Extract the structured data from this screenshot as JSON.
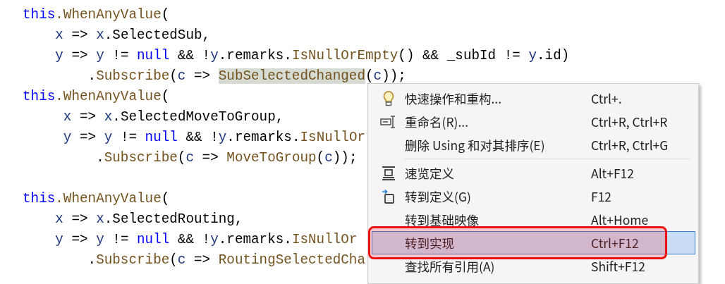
{
  "code_lines": [
    {
      "tokens": [
        {
          "text": "this",
          "kind": "keyword"
        },
        {
          "text": ".WhenAnyValue",
          "kind": "method"
        },
        {
          "text": "(",
          "kind": "plain"
        }
      ]
    },
    {
      "tokens": [
        {
          "text": "    x",
          "kind": "param"
        },
        {
          "text": " => ",
          "kind": "plain"
        },
        {
          "text": "x",
          "kind": "param"
        },
        {
          "text": ".SelectedSub,",
          "kind": "plain"
        }
      ]
    },
    {
      "tokens": [
        {
          "text": "    y",
          "kind": "param"
        },
        {
          "text": " => ",
          "kind": "plain"
        },
        {
          "text": "y",
          "kind": "param"
        },
        {
          "text": " != ",
          "kind": "plain"
        },
        {
          "text": "null",
          "kind": "keyword"
        },
        {
          "text": " && !",
          "kind": "plain"
        },
        {
          "text": "y",
          "kind": "param"
        },
        {
          "text": ".remarks.",
          "kind": "plain"
        },
        {
          "text": "IsNullOrEmpty",
          "kind": "method"
        },
        {
          "text": "() && _subId != ",
          "kind": "plain"
        },
        {
          "text": "y",
          "kind": "param"
        },
        {
          "text": ".id)",
          "kind": "plain"
        }
      ]
    },
    {
      "tokens": [
        {
          "text": "        .",
          "kind": "plain"
        },
        {
          "text": "Subscribe",
          "kind": "method"
        },
        {
          "text": "(",
          "kind": "plain"
        },
        {
          "text": "c",
          "kind": "param"
        },
        {
          "text": " => ",
          "kind": "plain"
        },
        {
          "text": "SubSelectedChanged",
          "kind": "method",
          "highlighted": true
        },
        {
          "text": "(",
          "kind": "plain"
        },
        {
          "text": "c",
          "kind": "param"
        },
        {
          "text": "));",
          "kind": "plain"
        }
      ]
    },
    {
      "tokens": [
        {
          "text": "this",
          "kind": "keyword"
        },
        {
          "text": ".WhenAnyValue",
          "kind": "method"
        },
        {
          "text": "(",
          "kind": "plain"
        }
      ]
    },
    {
      "tokens": [
        {
          "text": "     x",
          "kind": "param"
        },
        {
          "text": " => ",
          "kind": "plain"
        },
        {
          "text": "x",
          "kind": "param"
        },
        {
          "text": ".SelectedMoveToGroup,",
          "kind": "plain"
        }
      ]
    },
    {
      "tokens": [
        {
          "text": "     y",
          "kind": "param"
        },
        {
          "text": " => ",
          "kind": "plain"
        },
        {
          "text": "y",
          "kind": "param"
        },
        {
          "text": " != ",
          "kind": "plain"
        },
        {
          "text": "null",
          "kind": "keyword"
        },
        {
          "text": " && !",
          "kind": "plain"
        },
        {
          "text": "y",
          "kind": "param"
        },
        {
          "text": ".remarks.",
          "kind": "plain"
        },
        {
          "text": "IsNullOr",
          "kind": "method"
        }
      ]
    },
    {
      "tokens": [
        {
          "text": "         .",
          "kind": "plain"
        },
        {
          "text": "Subscribe",
          "kind": "method"
        },
        {
          "text": "(",
          "kind": "plain"
        },
        {
          "text": "c",
          "kind": "param"
        },
        {
          "text": " => ",
          "kind": "plain"
        },
        {
          "text": "MoveToGroup",
          "kind": "method"
        },
        {
          "text": "(",
          "kind": "plain"
        },
        {
          "text": "c",
          "kind": "param"
        },
        {
          "text": "));",
          "kind": "plain"
        }
      ]
    },
    {
      "blank_line_before": true,
      "tokens": [
        {
          "text": "this",
          "kind": "keyword"
        },
        {
          "text": ".WhenAnyValue",
          "kind": "method"
        },
        {
          "text": "(",
          "kind": "plain"
        }
      ]
    },
    {
      "tokens": [
        {
          "text": "    x",
          "kind": "param"
        },
        {
          "text": " => ",
          "kind": "plain"
        },
        {
          "text": "x",
          "kind": "param"
        },
        {
          "text": ".SelectedRouting,",
          "kind": "plain"
        }
      ]
    },
    {
      "tokens": [
        {
          "text": "    y",
          "kind": "param"
        },
        {
          "text": " => ",
          "kind": "plain"
        },
        {
          "text": "y",
          "kind": "param"
        },
        {
          "text": " != ",
          "kind": "plain"
        },
        {
          "text": "null",
          "kind": "keyword"
        },
        {
          "text": " && !",
          "kind": "plain"
        },
        {
          "text": "y",
          "kind": "param"
        },
        {
          "text": ".remarks.",
          "kind": "plain"
        },
        {
          "text": "IsNullOr",
          "kind": "method"
        }
      ]
    },
    {
      "tokens": [
        {
          "text": "        .",
          "kind": "plain"
        },
        {
          "text": "Subscribe",
          "kind": "method"
        },
        {
          "text": "(",
          "kind": "plain"
        },
        {
          "text": "c",
          "kind": "param"
        },
        {
          "text": " => ",
          "kind": "plain"
        },
        {
          "text": "RoutingSelectedCha",
          "kind": "method"
        }
      ]
    }
  ],
  "context_menu": {
    "items": [
      {
        "kind": "bulb",
        "label": "快速操作和重构...",
        "shortcut": "Ctrl+.",
        "selected": false,
        "annotated": false
      },
      {
        "kind": "rename",
        "label": "重命名(R)...",
        "shortcut": "Ctrl+R, Ctrl+R",
        "selected": false,
        "annotated": false
      },
      {
        "kind": "plain",
        "label": "删除 Using 和对其排序(E)",
        "shortcut": "Ctrl+R, Ctrl+G",
        "selected": false,
        "annotated": false
      },
      {
        "kind": "separator"
      },
      {
        "kind": "peek",
        "label": "速览定义",
        "shortcut": "Alt+F12",
        "selected": false,
        "annotated": false
      },
      {
        "kind": "goto",
        "label": "转到定义(G)",
        "shortcut": "F12",
        "selected": false,
        "annotated": false
      },
      {
        "kind": "plain",
        "label": "转到基础映像",
        "shortcut": "Alt+Home",
        "selected": false,
        "annotated": false
      },
      {
        "kind": "plain",
        "label": "转到实现",
        "shortcut": "Ctrl+F12",
        "selected": true,
        "annotated": true
      },
      {
        "kind": "plain",
        "label": "查找所有引用(A)",
        "shortcut": "Shift+F12",
        "selected": false,
        "annotated": false
      }
    ]
  }
}
